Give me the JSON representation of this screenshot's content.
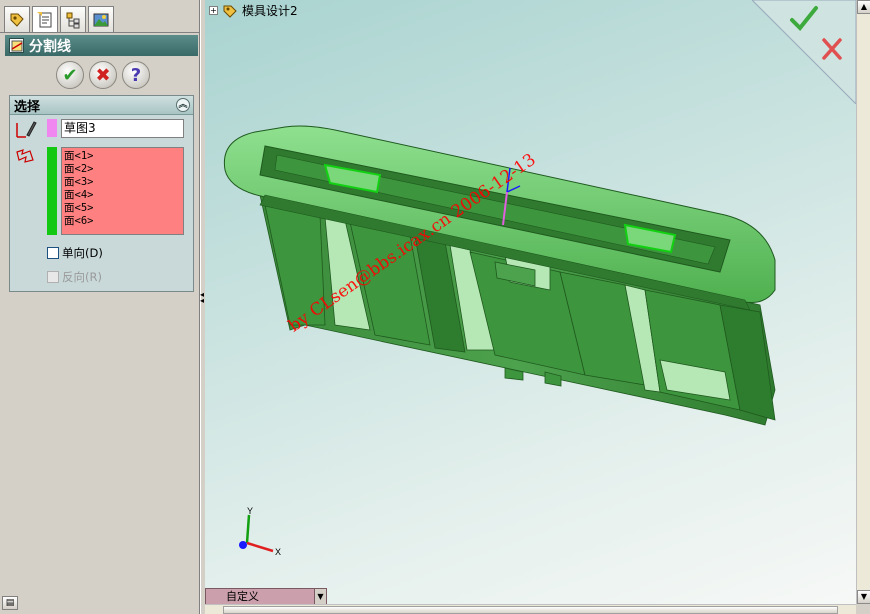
{
  "property_manager": {
    "tabs": [
      {
        "icon": "feature-manager-icon"
      },
      {
        "icon": "property-manager-icon"
      },
      {
        "icon": "configuration-manager-icon"
      },
      {
        "icon": "appearance-manager-icon"
      }
    ],
    "title": "分割线",
    "actions": {
      "ok": "✔",
      "cancel": "✖",
      "help": "?"
    },
    "selection_section": {
      "title": "选择",
      "sketch_value": "草图3",
      "faces": [
        "面<1>",
        "面<2>",
        "面<3>",
        "面<4>",
        "面<5>",
        "面<6>"
      ],
      "single_direction_label": "单向(D)",
      "single_direction_checked": false,
      "reverse_label": "反向(R)",
      "reverse_enabled": false
    }
  },
  "viewport": {
    "tree_root": "模具设计2",
    "watermark": "by CLsen@bbs.icax.cn 2006-12-13",
    "triad": {
      "x": "X",
      "y": "Y"
    },
    "config_dropdown": "自定义"
  },
  "colors": {
    "model_green": "#3d9a3d",
    "face_list_bg": "#ff8080",
    "selected_swatch": "#12c812",
    "sketch_swatch": "#f086f0",
    "watermark": "#ff0000",
    "header_teal": "#4a7c7a"
  }
}
